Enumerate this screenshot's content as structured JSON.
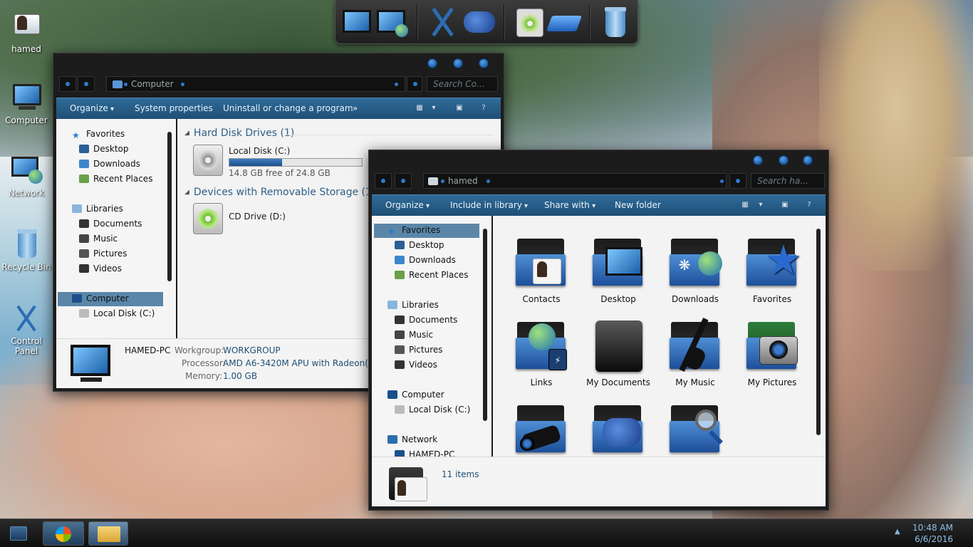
{
  "desktop": {
    "icons": [
      {
        "label": "hamed",
        "icon": "user-folder-icon"
      },
      {
        "label": "Computer",
        "icon": "computer-icon"
      },
      {
        "label": "Network",
        "icon": "network-icon"
      },
      {
        "label": "Recycle Bin",
        "icon": "recycle-bin-icon"
      },
      {
        "label": "Control Panel",
        "icon": "control-panel-icon"
      }
    ]
  },
  "dock": {
    "items": [
      "computer-icon",
      "network-icon",
      "tools-icon",
      "gamepad-icon",
      "disk-icon",
      "cd-drive-icon",
      "recycle-bin-icon"
    ]
  },
  "computer_window": {
    "address": "Computer",
    "search_placeholder": "Search Co...",
    "commands": {
      "organize": "Organize",
      "system_properties": "System properties",
      "uninstall": "Uninstall or change a program",
      "more": "»"
    },
    "nav": {
      "favorites": "Favorites",
      "desktop": "Desktop",
      "downloads": "Downloads",
      "recent": "Recent Places",
      "libraries": "Libraries",
      "documents": "Documents",
      "music": "Music",
      "pictures": "Pictures",
      "videos": "Videos",
      "computer": "Computer",
      "local_disk": "Local Disk (C:)"
    },
    "groups": {
      "hard_disks": "Hard Disk Drives (1)",
      "removable": "Devices with Removable Storage (1)"
    },
    "drives": {
      "c_name": "Local Disk (C:)",
      "c_free": "14.8 GB free of 24.8 GB",
      "c_used_fraction": 0.4,
      "d_name": "CD Drive (D:)"
    },
    "details": {
      "pc_name": "HAMED-PC",
      "workgroup_label": "Workgroup:",
      "workgroup": "WORKGROUP",
      "processor_label": "Processor:",
      "processor": "AMD A6-3420M APU with Radeon(tm)",
      "memory_label": "Memory:",
      "memory": "1.00 GB"
    }
  },
  "hamed_window": {
    "address": "hamed",
    "search_placeholder": "Search ha...",
    "commands": {
      "organize": "Organize",
      "include": "Include in library",
      "share": "Share with",
      "new_folder": "New folder"
    },
    "nav": {
      "favorites": "Favorites",
      "desktop": "Desktop",
      "downloads": "Downloads",
      "recent": "Recent Places",
      "libraries": "Libraries",
      "documents": "Documents",
      "music": "Music",
      "pictures": "Pictures",
      "videos": "Videos",
      "computer": "Computer",
      "local_disk": "Local Disk (C:)",
      "network": "Network",
      "hamed_pc": "HAMED-PC"
    },
    "folders": [
      "Contacts",
      "Desktop",
      "Downloads",
      "Favorites",
      "Links",
      "My Documents",
      "My Music",
      "My Pictures",
      "",
      "",
      ""
    ],
    "status": "11 items"
  },
  "taskbar": {
    "time": "10:48 AM",
    "date": "6/6/2016"
  },
  "colors": {
    "accent": "#2c7bd0",
    "cmdbar": "#2a5f88",
    "selection": "#5b86a8"
  }
}
